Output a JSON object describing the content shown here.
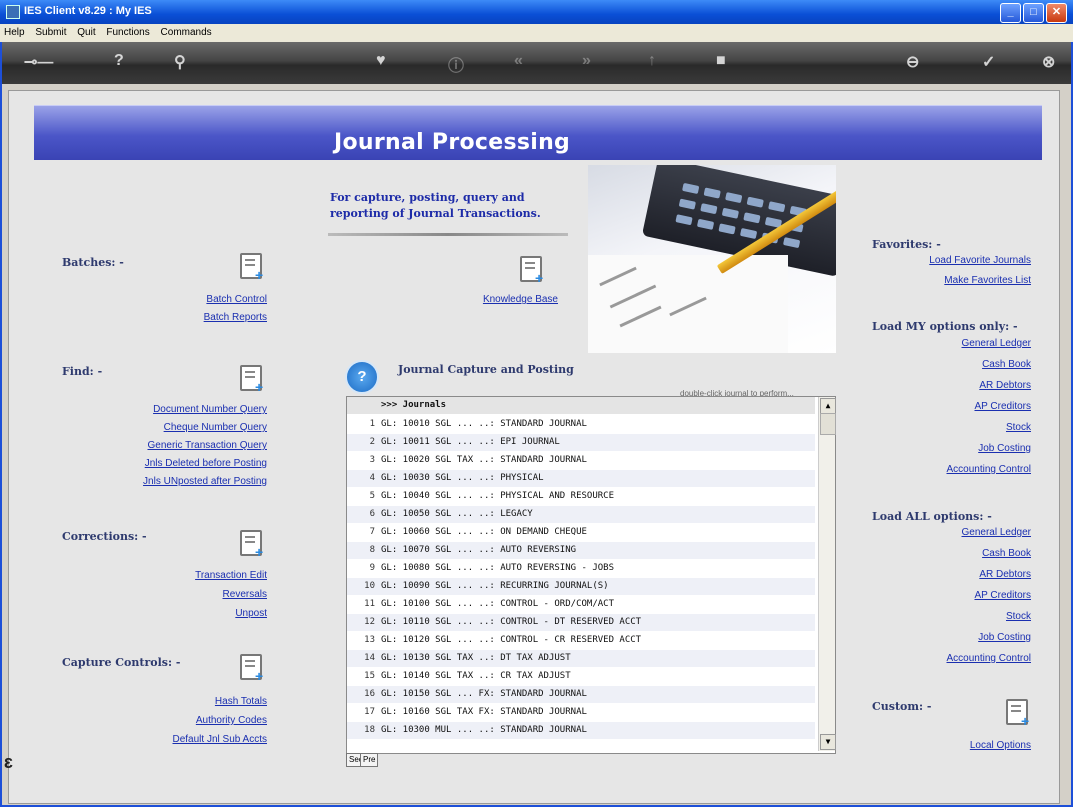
{
  "window": {
    "title": "IES Client v8.29 : My IES"
  },
  "menu": [
    "Help",
    "Submit",
    "Quit",
    "Functions",
    "Commands"
  ],
  "page": {
    "title": "Journal Processing",
    "intro_line1": "For capture, posting, query and",
    "intro_line2": "reporting of Journal Transactions."
  },
  "left": {
    "batches": {
      "heading": "Batches: -",
      "links": [
        "Batch Control",
        "Batch Reports"
      ]
    },
    "find": {
      "heading": "Find: -",
      "links": [
        "Document Number Query",
        "Cheque Number Query",
        "Generic Transaction Query",
        "Jnls Deleted before Posting",
        "Jnls UNposted after Posting"
      ]
    },
    "corrections": {
      "heading": "Corrections: -",
      "links": [
        "Transaction Edit",
        "Reversals",
        "Unpost"
      ]
    },
    "capture_controls": {
      "heading": "Capture Controls: -",
      "links": [
        "Hash Totals",
        "Authority Codes",
        "Default Jnl Sub Accts"
      ]
    }
  },
  "center": {
    "knowledge_base": "Knowledge Base",
    "capture_title": "Journal Capture and Posting",
    "hint": "double-click journal to perform...",
    "list_header": ">>> Journals",
    "rows": [
      {
        "n": "1",
        "t": "GL: 10010 SGL ... ..: STANDARD JOURNAL"
      },
      {
        "n": "2",
        "t": "GL: 10011 SGL ... ..: EPI JOURNAL"
      },
      {
        "n": "3",
        "t": "GL: 10020 SGL TAX ..: STANDARD JOURNAL"
      },
      {
        "n": "4",
        "t": "GL: 10030 SGL ... ..: PHYSICAL"
      },
      {
        "n": "5",
        "t": "GL: 10040 SGL ... ..: PHYSICAL AND RESOURCE"
      },
      {
        "n": "6",
        "t": "GL: 10050 SGL ... ..: LEGACY"
      },
      {
        "n": "7",
        "t": "GL: 10060 SGL ... ..: ON DEMAND CHEQUE"
      },
      {
        "n": "8",
        "t": "GL: 10070 SGL ... ..: AUTO REVERSING"
      },
      {
        "n": "9",
        "t": "GL: 10080 SGL ... ..: AUTO REVERSING - JOBS"
      },
      {
        "n": "10",
        "t": "GL: 10090 SGL ... ..: RECURRING JOURNAL(S)"
      },
      {
        "n": "11",
        "t": "GL: 10100 SGL ... ..: CONTROL - ORD/COM/ACT"
      },
      {
        "n": "12",
        "t": "GL: 10110 SGL ... ..: CONTROL - DT RESERVED ACCT"
      },
      {
        "n": "13",
        "t": "GL: 10120 SGL ... ..: CONTROL - CR RESERVED ACCT"
      },
      {
        "n": "14",
        "t": "GL: 10130 SGL TAX ..: DT TAX ADJUST"
      },
      {
        "n": "15",
        "t": "GL: 10140 SGL TAX ..: CR TAX ADJUST"
      },
      {
        "n": "16",
        "t": "GL: 10150 SGL ... FX: STANDARD JOURNAL"
      },
      {
        "n": "17",
        "t": "GL: 10160 SGL TAX FX: STANDARD JOURNAL"
      },
      {
        "n": "18",
        "t": "GL: 10300 MUL ... ..: STANDARD JOURNAL"
      }
    ],
    "btn_sec": "Sec",
    "btn_pre": "Pre"
  },
  "right": {
    "favorites": {
      "heading": "Favorites: -",
      "links": [
        "Load Favorite Journals",
        "Make Favorites List"
      ]
    },
    "load_my": {
      "heading": "Load MY options only: -",
      "links": [
        "General Ledger",
        "Cash Book",
        "AR Debtors",
        "AP Creditors",
        "Stock",
        "Job Costing",
        "Accounting Control"
      ]
    },
    "load_all": {
      "heading": "Load ALL options: -",
      "links": [
        "General Ledger",
        "Cash Book",
        "AR Debtors",
        "AP Creditors",
        "Stock",
        "Job Costing",
        "Accounting Control"
      ]
    },
    "custom": {
      "heading": "Custom: -",
      "links": [
        "Local Options"
      ]
    }
  },
  "toolbar_icons": [
    "key-icon",
    "help-icon",
    "search-icon",
    "heart-icon",
    "info-icon",
    "rewind-icon",
    "forward-icon",
    "up-icon",
    "square-icon",
    "minus-icon",
    "check-icon",
    "close-icon"
  ]
}
